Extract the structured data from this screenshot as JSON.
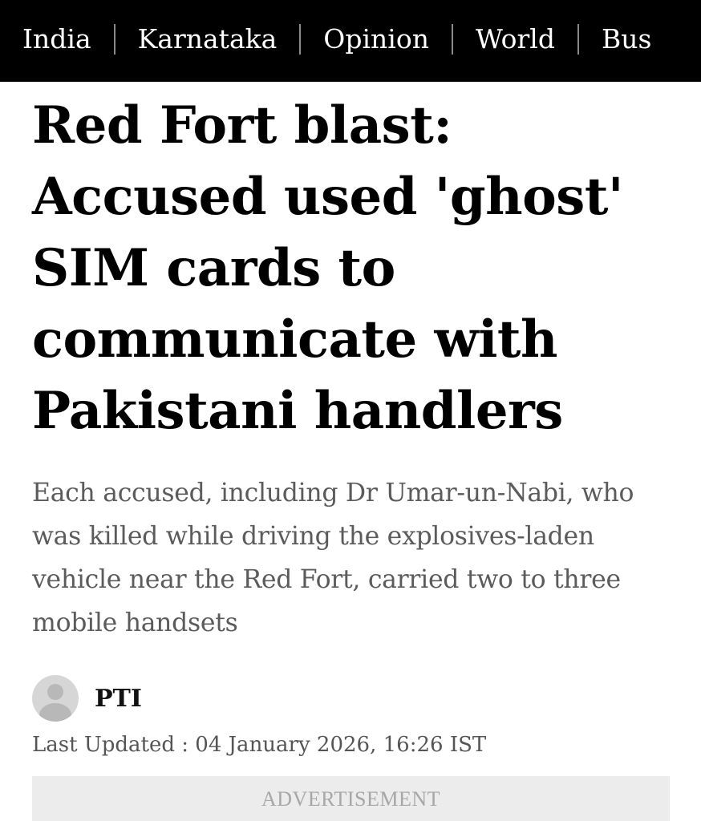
{
  "nav": {
    "items": [
      {
        "label": "India"
      },
      {
        "label": "Karnataka"
      },
      {
        "label": "Opinion"
      },
      {
        "label": "World"
      },
      {
        "label": "Bus"
      }
    ]
  },
  "article": {
    "headline": "Red Fort blast: Accused used 'ghost' SIM cards to communicate with Pakistani handlers",
    "summary": "Each accused, including Dr Umar-un-Nabi, who was killed while driving the explosives-laden vehicle near the Red Fort, carried two to three mobile handsets",
    "author": "PTI",
    "avatar_icon": "user-avatar-icon",
    "last_updated": "Last Updated : 04 January 2026, 16:26 IST"
  },
  "advertisement": {
    "label": "ADVERTISEMENT"
  }
}
